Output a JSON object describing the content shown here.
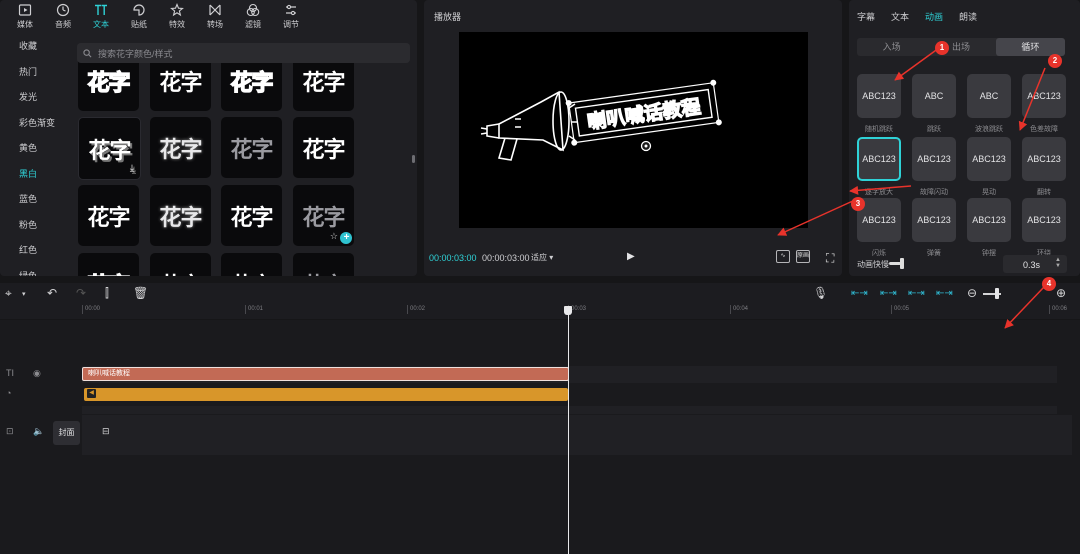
{
  "toolbar": {
    "items": [
      {
        "label": "媒体",
        "icon": "media-icon"
      },
      {
        "label": "音频",
        "icon": "audio-icon"
      },
      {
        "label": "文本",
        "icon": "text-icon",
        "active": true
      },
      {
        "label": "贴纸",
        "icon": "sticker-icon"
      },
      {
        "label": "特效",
        "icon": "effects-icon"
      },
      {
        "label": "转场",
        "icon": "transition-icon"
      },
      {
        "label": "滤镜",
        "icon": "filter-icon"
      },
      {
        "label": "调节",
        "icon": "adjust-icon"
      }
    ]
  },
  "sidebar": {
    "items": [
      "收藏",
      "热门",
      "发光",
      "彩色渐变",
      "黄色",
      "黑白",
      "蓝色",
      "粉色",
      "红色",
      "绿色"
    ],
    "active_index": 5
  },
  "search": {
    "placeholder": "搜索花字颜色/样式"
  },
  "gallery": {
    "tile_text": "花字"
  },
  "player": {
    "title": "播放器",
    "time_current": "00:00:03:00",
    "time_total": "00:00:03:00",
    "ratio_label": "适应",
    "overlay_text": "喇叭喊话教程",
    "btn1_label": "",
    "btn2_label": "原画"
  },
  "props": {
    "tabs": [
      "字幕",
      "文本",
      "动画",
      "朗读"
    ],
    "active_tab": "动画",
    "segments": [
      "入场",
      "出场",
      "循环"
    ],
    "active_segment": "循环",
    "animations": [
      {
        "preview": "ABC123",
        "label": "随机跳跃"
      },
      {
        "preview": "ABC",
        "label": "跳跃"
      },
      {
        "preview": "ABC",
        "label": "波浪跳跃"
      },
      {
        "preview": "ABC123",
        "label": "色差故障"
      },
      {
        "preview": "ABC123",
        "label": "逐字放大",
        "selected": true
      },
      {
        "preview": "ABC123",
        "label": "故障闪动"
      },
      {
        "preview": "ABC123",
        "label": "晃动"
      },
      {
        "preview": "ABC123",
        "label": "翻转"
      },
      {
        "preview": "ABC123",
        "label": "闪烁"
      },
      {
        "preview": "ABC123",
        "label": "弹簧"
      },
      {
        "preview": "ABC123",
        "label": "钟摆"
      },
      {
        "preview": "ABC123",
        "label": "环绕"
      }
    ],
    "speed_label": "动画快慢",
    "speed_value": "0.3s"
  },
  "timeline": {
    "ruler": [
      "00:00",
      "00:01",
      "00:02",
      "00:03",
      "00:04",
      "00:05",
      "00:06"
    ],
    "text_clip_label": "喇叭喊话教程",
    "cover_label": "封面"
  },
  "annotations": [
    "1",
    "2",
    "3",
    "4"
  ],
  "colors": {
    "accent": "#2fd2d7",
    "text_clip": "#c26a55",
    "anim_clip": "#d8962a",
    "badge": "#e8332b"
  }
}
